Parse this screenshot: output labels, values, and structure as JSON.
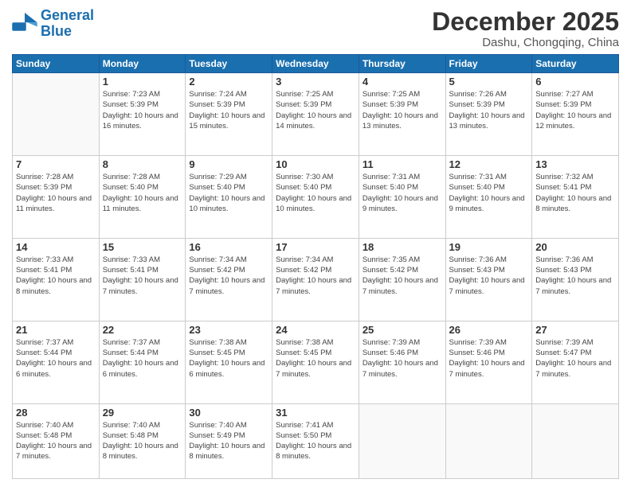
{
  "logo": {
    "line1": "General",
    "line2": "Blue"
  },
  "title": "December 2025",
  "location": "Dashu, Chongqing, China",
  "weekdays": [
    "Sunday",
    "Monday",
    "Tuesday",
    "Wednesday",
    "Thursday",
    "Friday",
    "Saturday"
  ],
  "weeks": [
    [
      {
        "day": "",
        "sunrise": "",
        "sunset": "",
        "daylight": ""
      },
      {
        "day": "1",
        "sunrise": "7:23 AM",
        "sunset": "5:39 PM",
        "daylight": "10 hours and 16 minutes."
      },
      {
        "day": "2",
        "sunrise": "7:24 AM",
        "sunset": "5:39 PM",
        "daylight": "10 hours and 15 minutes."
      },
      {
        "day": "3",
        "sunrise": "7:25 AM",
        "sunset": "5:39 PM",
        "daylight": "10 hours and 14 minutes."
      },
      {
        "day": "4",
        "sunrise": "7:25 AM",
        "sunset": "5:39 PM",
        "daylight": "10 hours and 13 minutes."
      },
      {
        "day": "5",
        "sunrise": "7:26 AM",
        "sunset": "5:39 PM",
        "daylight": "10 hours and 13 minutes."
      },
      {
        "day": "6",
        "sunrise": "7:27 AM",
        "sunset": "5:39 PM",
        "daylight": "10 hours and 12 minutes."
      }
    ],
    [
      {
        "day": "7",
        "sunrise": "7:28 AM",
        "sunset": "5:39 PM",
        "daylight": "10 hours and 11 minutes."
      },
      {
        "day": "8",
        "sunrise": "7:28 AM",
        "sunset": "5:40 PM",
        "daylight": "10 hours and 11 minutes."
      },
      {
        "day": "9",
        "sunrise": "7:29 AM",
        "sunset": "5:40 PM",
        "daylight": "10 hours and 10 minutes."
      },
      {
        "day": "10",
        "sunrise": "7:30 AM",
        "sunset": "5:40 PM",
        "daylight": "10 hours and 10 minutes."
      },
      {
        "day": "11",
        "sunrise": "7:31 AM",
        "sunset": "5:40 PM",
        "daylight": "10 hours and 9 minutes."
      },
      {
        "day": "12",
        "sunrise": "7:31 AM",
        "sunset": "5:40 PM",
        "daylight": "10 hours and 9 minutes."
      },
      {
        "day": "13",
        "sunrise": "7:32 AM",
        "sunset": "5:41 PM",
        "daylight": "10 hours and 8 minutes."
      }
    ],
    [
      {
        "day": "14",
        "sunrise": "7:33 AM",
        "sunset": "5:41 PM",
        "daylight": "10 hours and 8 minutes."
      },
      {
        "day": "15",
        "sunrise": "7:33 AM",
        "sunset": "5:41 PM",
        "daylight": "10 hours and 7 minutes."
      },
      {
        "day": "16",
        "sunrise": "7:34 AM",
        "sunset": "5:42 PM",
        "daylight": "10 hours and 7 minutes."
      },
      {
        "day": "17",
        "sunrise": "7:34 AM",
        "sunset": "5:42 PM",
        "daylight": "10 hours and 7 minutes."
      },
      {
        "day": "18",
        "sunrise": "7:35 AM",
        "sunset": "5:42 PM",
        "daylight": "10 hours and 7 minutes."
      },
      {
        "day": "19",
        "sunrise": "7:36 AM",
        "sunset": "5:43 PM",
        "daylight": "10 hours and 7 minutes."
      },
      {
        "day": "20",
        "sunrise": "7:36 AM",
        "sunset": "5:43 PM",
        "daylight": "10 hours and 7 minutes."
      }
    ],
    [
      {
        "day": "21",
        "sunrise": "7:37 AM",
        "sunset": "5:44 PM",
        "daylight": "10 hours and 6 minutes."
      },
      {
        "day": "22",
        "sunrise": "7:37 AM",
        "sunset": "5:44 PM",
        "daylight": "10 hours and 6 minutes."
      },
      {
        "day": "23",
        "sunrise": "7:38 AM",
        "sunset": "5:45 PM",
        "daylight": "10 hours and 6 minutes."
      },
      {
        "day": "24",
        "sunrise": "7:38 AM",
        "sunset": "5:45 PM",
        "daylight": "10 hours and 7 minutes."
      },
      {
        "day": "25",
        "sunrise": "7:39 AM",
        "sunset": "5:46 PM",
        "daylight": "10 hours and 7 minutes."
      },
      {
        "day": "26",
        "sunrise": "7:39 AM",
        "sunset": "5:46 PM",
        "daylight": "10 hours and 7 minutes."
      },
      {
        "day": "27",
        "sunrise": "7:39 AM",
        "sunset": "5:47 PM",
        "daylight": "10 hours and 7 minutes."
      }
    ],
    [
      {
        "day": "28",
        "sunrise": "7:40 AM",
        "sunset": "5:48 PM",
        "daylight": "10 hours and 7 minutes."
      },
      {
        "day": "29",
        "sunrise": "7:40 AM",
        "sunset": "5:48 PM",
        "daylight": "10 hours and 8 minutes."
      },
      {
        "day": "30",
        "sunrise": "7:40 AM",
        "sunset": "5:49 PM",
        "daylight": "10 hours and 8 minutes."
      },
      {
        "day": "31",
        "sunrise": "7:41 AM",
        "sunset": "5:50 PM",
        "daylight": "10 hours and 8 minutes."
      },
      {
        "day": "",
        "sunrise": "",
        "sunset": "",
        "daylight": ""
      },
      {
        "day": "",
        "sunrise": "",
        "sunset": "",
        "daylight": ""
      },
      {
        "day": "",
        "sunrise": "",
        "sunset": "",
        "daylight": ""
      }
    ]
  ]
}
